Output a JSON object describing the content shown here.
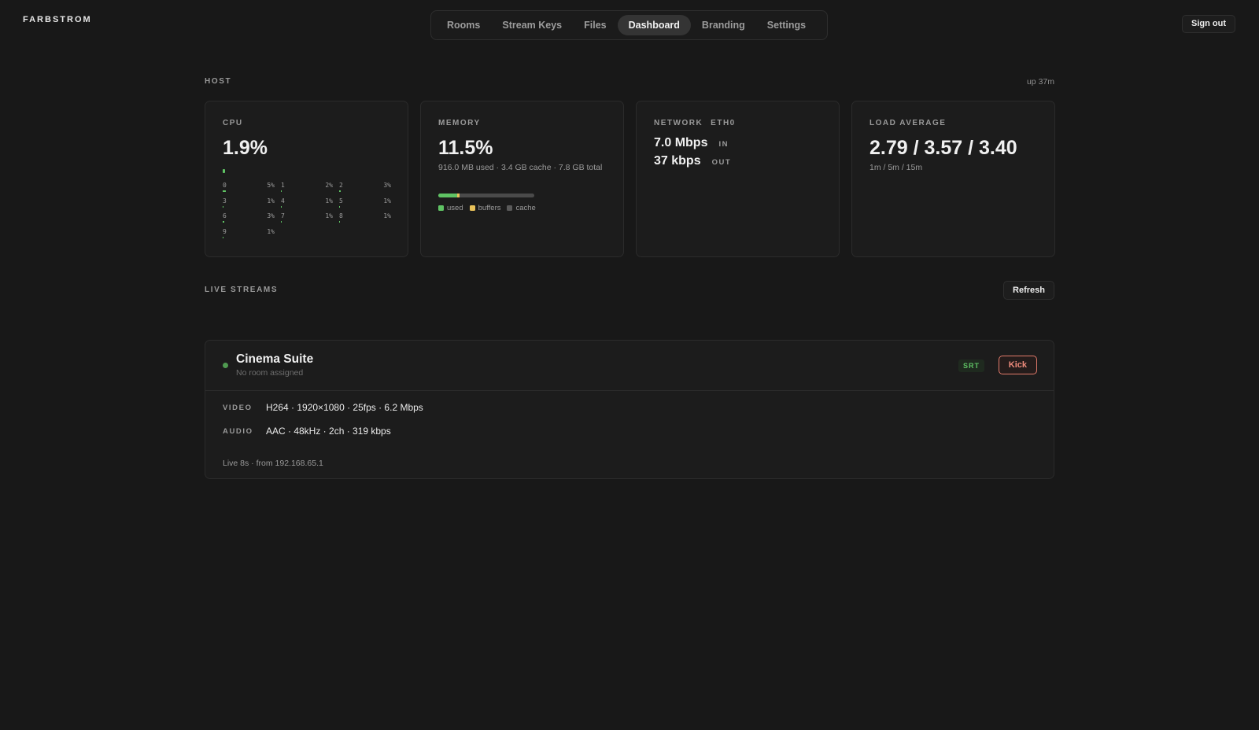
{
  "brand": "FARBSTROM",
  "nav": {
    "items": [
      "Rooms",
      "Stream Keys",
      "Files",
      "Dashboard",
      "Branding",
      "Settings"
    ],
    "active": "Dashboard"
  },
  "header": {
    "sign_out": "Sign out"
  },
  "host": {
    "label": "HOST",
    "uptime": "up 37m",
    "cpu": {
      "label": "CPU",
      "value": "1.9%",
      "usage_fraction": 0.019,
      "cores": [
        {
          "id": "0",
          "pct": "5%"
        },
        {
          "id": "1",
          "pct": "2%"
        },
        {
          "id": "2",
          "pct": "3%"
        },
        {
          "id": "3",
          "pct": "1%"
        },
        {
          "id": "4",
          "pct": "1%"
        },
        {
          "id": "5",
          "pct": "1%"
        },
        {
          "id": "6",
          "pct": "3%"
        },
        {
          "id": "7",
          "pct": "1%"
        },
        {
          "id": "8",
          "pct": "1%"
        },
        {
          "id": "9",
          "pct": "1%"
        }
      ]
    },
    "memory": {
      "label": "MEMORY",
      "value": "11.5%",
      "detail": "916.0 MB used · 3.4 GB cache · 7.8 GB total",
      "used_fraction": 0.2,
      "buffers_fraction": 0.02,
      "legend": [
        "used",
        "buffers",
        "cache"
      ]
    },
    "network": {
      "label": "NETWORK",
      "iface": "ETH0",
      "in_value": "7.0 Mbps",
      "in_label": "IN",
      "out_value": "37 kbps",
      "out_label": "OUT"
    },
    "load": {
      "label": "LOAD AVERAGE",
      "value": "2.79 / 3.57 / 3.40",
      "detail": "1m / 5m / 15m"
    }
  },
  "live_streams": {
    "label": "LIVE STREAMS",
    "refresh": "Refresh",
    "items": [
      {
        "name": "Cinema Suite",
        "room": "No room assigned",
        "protocol": "SRT",
        "kick": "Kick",
        "video_label": "VIDEO",
        "video": "H264 · 1920×1080 · 25fps · 6.2 Mbps",
        "audio_label": "AUDIO",
        "audio": "AAC · 48kHz · 2ch · 319 kbps",
        "footer": "Live 8s · from 192.168.65.1"
      }
    ]
  },
  "colors": {
    "accent_green": "#5fc364",
    "buffers_yellow": "#e9c25a",
    "kick_red": "#ee8b7c"
  }
}
